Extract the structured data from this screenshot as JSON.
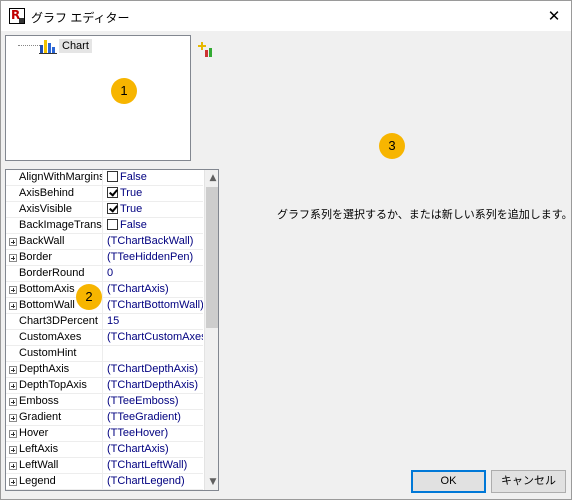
{
  "window": {
    "title": "グラフ エディター",
    "close_glyph": "✕",
    "app_icon_letter": "R"
  },
  "tree": {
    "root_label": "Chart"
  },
  "properties": [
    {
      "name": "AlignWithMargins",
      "value": "False",
      "type": "checkbox",
      "checked": false
    },
    {
      "name": "AxisBehind",
      "value": "True",
      "type": "checkbox",
      "checked": true
    },
    {
      "name": "AxisVisible",
      "value": "True",
      "type": "checkbox",
      "checked": true
    },
    {
      "name": "BackImageTransp",
      "value": "False",
      "type": "checkbox",
      "checked": false
    },
    {
      "name": "BackWall",
      "value": "(TChartBackWall)",
      "expandable": true
    },
    {
      "name": "Border",
      "value": "(TTeeHiddenPen)",
      "expandable": true
    },
    {
      "name": "BorderRound",
      "value": "0"
    },
    {
      "name": "BottomAxis",
      "value": "(TChartAxis)",
      "expandable": true
    },
    {
      "name": "BottomWall",
      "value": "(TChartBottomWall)",
      "expandable": true
    },
    {
      "name": "Chart3DPercent",
      "value": "15"
    },
    {
      "name": "CustomAxes",
      "value": "(TChartCustomAxes"
    },
    {
      "name": "CustomHint",
      "value": ""
    },
    {
      "name": "DepthAxis",
      "value": "(TChartDepthAxis)",
      "expandable": true
    },
    {
      "name": "DepthTopAxis",
      "value": "(TChartDepthAxis)",
      "expandable": true
    },
    {
      "name": "Emboss",
      "value": "(TTeeEmboss)",
      "expandable": true
    },
    {
      "name": "Gradient",
      "value": "(TTeeGradient)",
      "expandable": true
    },
    {
      "name": "Hover",
      "value": "(TTeeHover)",
      "expandable": true
    },
    {
      "name": "LeftAxis",
      "value": "(TChartAxis)",
      "expandable": true
    },
    {
      "name": "LeftWall",
      "value": "(TChartLeftWall)",
      "expandable": true
    },
    {
      "name": "Legend",
      "value": "(TChartLegend)",
      "expandable": true
    }
  ],
  "scrollbar": {
    "up_glyph": "▲",
    "down_glyph": "▼"
  },
  "badges": {
    "one": "1",
    "two": "2",
    "three": "3"
  },
  "message": "グラフ系列を選択するか、または新しい系列を追加します。",
  "buttons": {
    "ok": "OK",
    "cancel": "キャンセル"
  },
  "colors": {
    "badge": "#f7b500",
    "value_text": "#000080"
  }
}
